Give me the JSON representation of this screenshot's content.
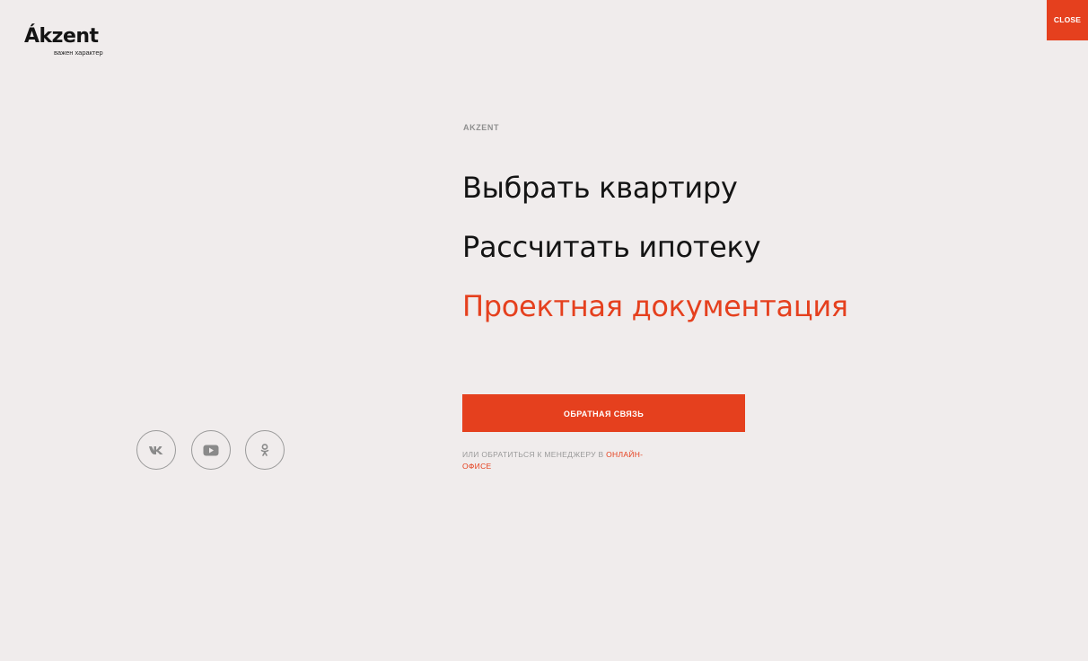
{
  "brand": {
    "logo_text": "Ákzent",
    "tagline": "важен характер"
  },
  "header": {
    "close_label": "CLOSE"
  },
  "menu": {
    "eyebrow": "AKZENT",
    "items": [
      {
        "label": "Выбрать квартиру",
        "active": false
      },
      {
        "label": "Рассчитать ипотеку",
        "active": false
      },
      {
        "label": "Проектная документация",
        "active": true
      }
    ]
  },
  "cta": {
    "feedback_label": "ОБРАТНАЯ СВЯЗЬ",
    "note_prefix": "ИЛИ ОБРАТИТЬСЯ К МЕНЕДЖЕРУ В",
    "note_link": "ОНЛАЙН-ОФИСЕ"
  },
  "social": [
    {
      "icon": "vk-icon"
    },
    {
      "icon": "youtube-icon"
    },
    {
      "icon": "odnoklassniki-icon"
    }
  ],
  "colors": {
    "accent": "#e5401e",
    "background": "#f0ecec",
    "text": "#141414",
    "muted": "#9a9a9a"
  }
}
